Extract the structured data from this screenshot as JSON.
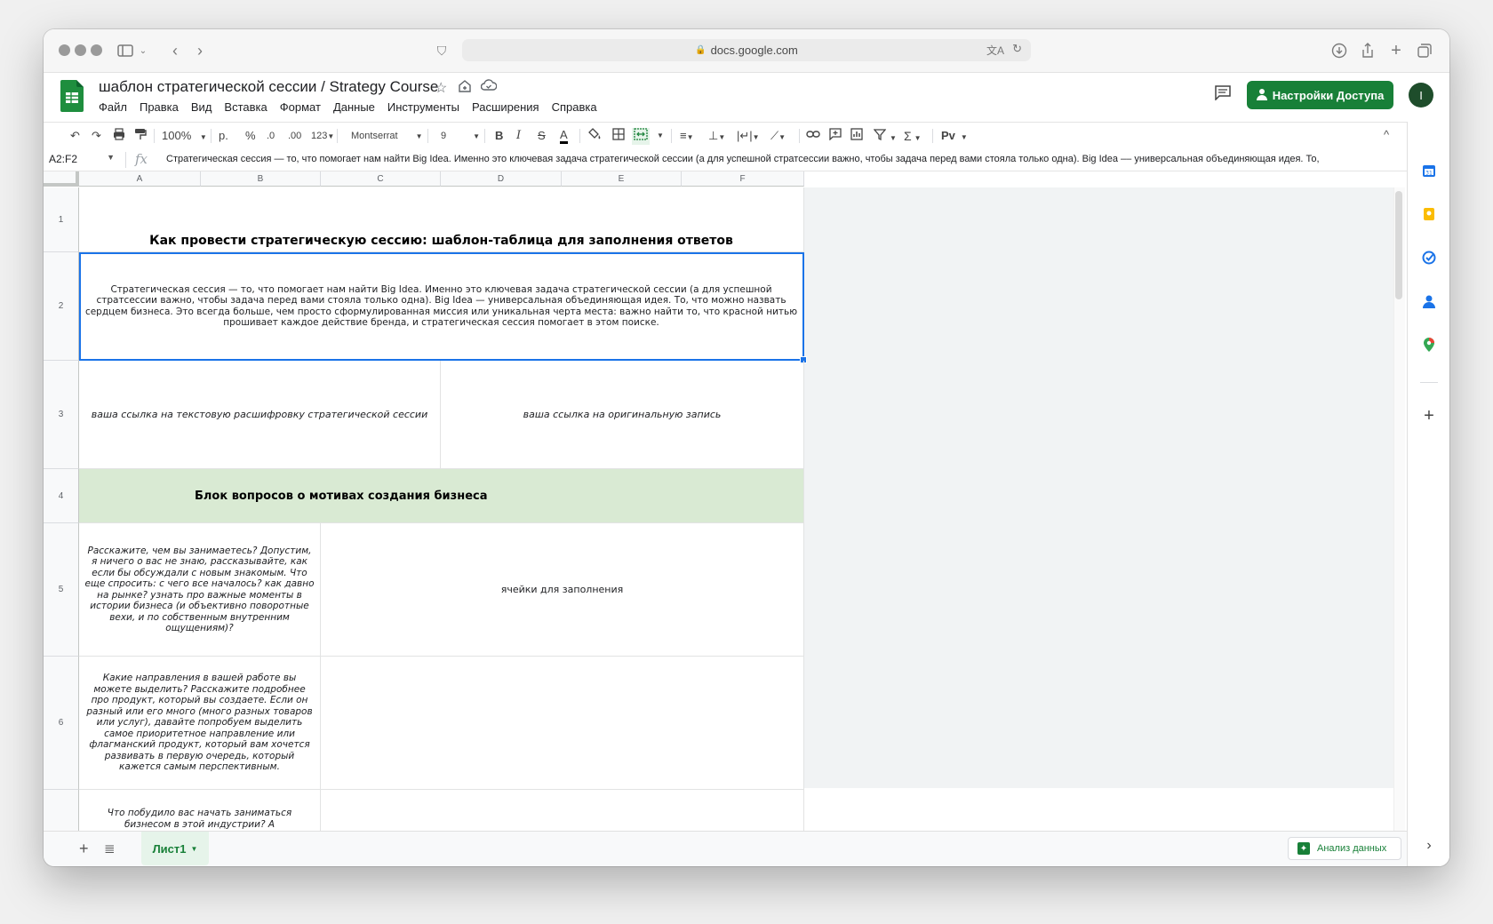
{
  "browser": {
    "url": "docs.google.com"
  },
  "doc": {
    "title": "шаблон стратегической сессии / Strategy Course"
  },
  "menu": [
    "Файл",
    "Правка",
    "Вид",
    "Вставка",
    "Формат",
    "Данные",
    "Инструменты",
    "Расширения",
    "Справка"
  ],
  "header": {
    "share_label": "Настройки Доступа",
    "avatar_letter": "I"
  },
  "toolbar": {
    "zoom": "100%",
    "currency": "р.",
    "percent": "%",
    "dec_decrease": ".0",
    "dec_increase": ".00",
    "number_format": "123",
    "font": "Montserrat",
    "font_size": "9",
    "bold": "B",
    "italic": "I",
    "strike": "S",
    "text_color": "A"
  },
  "formula_bar": {
    "name_box": "A2:F2",
    "fx": "fx",
    "content": "Стратегическая сессия — то, что помогает нам найти Big Idea. Именно это ключевая задача стратегической сессии (а для успешной стратсессии важно, чтобы задача перед вами стояла только одна). Big Idea –– универсальная объединяющая идея. То,"
  },
  "columns": [
    "A",
    "B",
    "C",
    "D",
    "E",
    "F"
  ],
  "rows": [
    "1",
    "2",
    "3",
    "4",
    "5",
    "6"
  ],
  "cells": {
    "r1": "Как провести стратегическую сессию: шаблон-таблица для заполнения ответов",
    "r2": "Стратегическая сессия — то, что помогает нам найти Big Idea. Именно это ключевая задача стратегической сессии (а для успешной стратсессии важно, чтобы задача перед вами стояла только одна). Big Idea — универсальная объединяющая идея. То, что можно назвать сердцем бизнеса. Это всегда больше, чем просто сформулированная миссия или уникальная черта места: важно найти то, что красной нитью прошивает каждое действие бренда, и стратегическая сессия помогает в этом поиске.",
    "r3_left": "ваша ссылка на текстовую расшифровку стратегической сессии",
    "r3_right": "ваша ссылка на оригинальную запись",
    "r4": "Блок вопросов о мотивах создания бизнеса",
    "r5_q": "Расскажите, чем вы занимаетесь? Допустим, я ничего о вас не знаю, рассказывайте, как если бы обсуждали с новым знакомым. Что еще спросить: с чего все началось? как давно на рынке? узнать про важные моменты в истории бизнеса (и объективно поворотные вехи, и по собственным внутренним ощущениям)?",
    "r5_a": "ячейки для заполнения",
    "r6_q": "Какие направления в вашей работе вы можете выделить? Расскажите подробнее про продукт, который вы создаете. Если он разный или его много (много разных товаров или услуг), давайте попробуем выделить самое приоритетное направление или флагманский продукт, который вам хочется развивать в первую очередь, который кажется самым перспективным.",
    "r7_q": "Что побудило вас начать заниматься бизнесом в этой индустрии? А почему"
  },
  "bottom": {
    "sheet_name": "Лист1",
    "explore_label": "Анализ данных"
  },
  "colors": {
    "green_accent": "#188038",
    "header_fill": "#d9ead3",
    "selection": "#1a73e8"
  },
  "icons": [
    "sheets-logo-icon",
    "star-icon",
    "move-icon",
    "cloud-icon",
    "comment-icon",
    "person-icon",
    "undo-icon",
    "redo-icon",
    "print-icon",
    "paint-format-icon",
    "fill-color-icon",
    "borders-icon",
    "merge-icon",
    "align-icon",
    "valign-icon",
    "wrap-icon",
    "rotate-icon",
    "link-icon",
    "add-comment-icon",
    "chart-icon",
    "filter-icon",
    "functions-icon",
    "input-tools-icon",
    "calendar-icon",
    "keep-icon",
    "tasks-icon",
    "contacts-icon",
    "maps-icon",
    "plus-icon"
  ]
}
